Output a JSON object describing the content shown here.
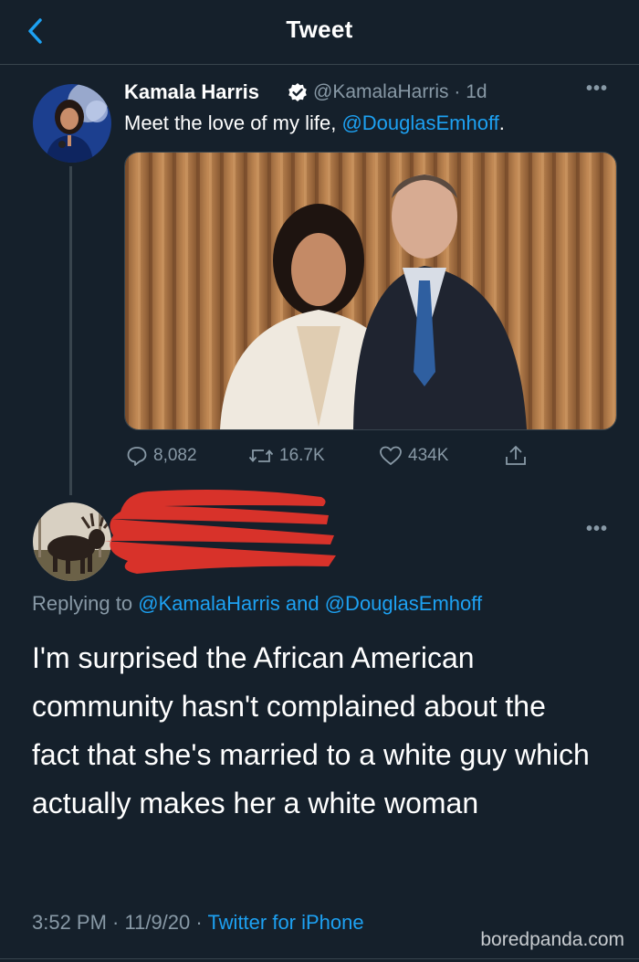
{
  "header": {
    "title": "Tweet"
  },
  "tweet": {
    "author_name": "Kamala Harris",
    "handle": "@KamalaHarris",
    "separator": "·",
    "time": "1d",
    "text_prefix": "Meet the love of my life, ",
    "mention": "@DouglasEmhoff",
    "text_suffix": ".",
    "stats": {
      "replies": "8,082",
      "retweets": "16.7K",
      "likes": "434K"
    }
  },
  "reply": {
    "replying_prefix": "Replying to ",
    "mention_1": "@KamalaHarris",
    "and_word": " and ",
    "mention_2": "@DouglasEmhoff",
    "text": "I'm surprised the African American community hasn't complained about the fact that she's married to a white guy which actually makes her a white woman",
    "time": "3:52 PM",
    "date": "11/9/20",
    "sep": " · ",
    "source": "Twitter for iPhone"
  },
  "watermark": "boredpanda.com",
  "colors": {
    "background": "#15202b",
    "accent": "#1da1f2",
    "muted": "#8899a6",
    "redaction": "#d8322a"
  }
}
